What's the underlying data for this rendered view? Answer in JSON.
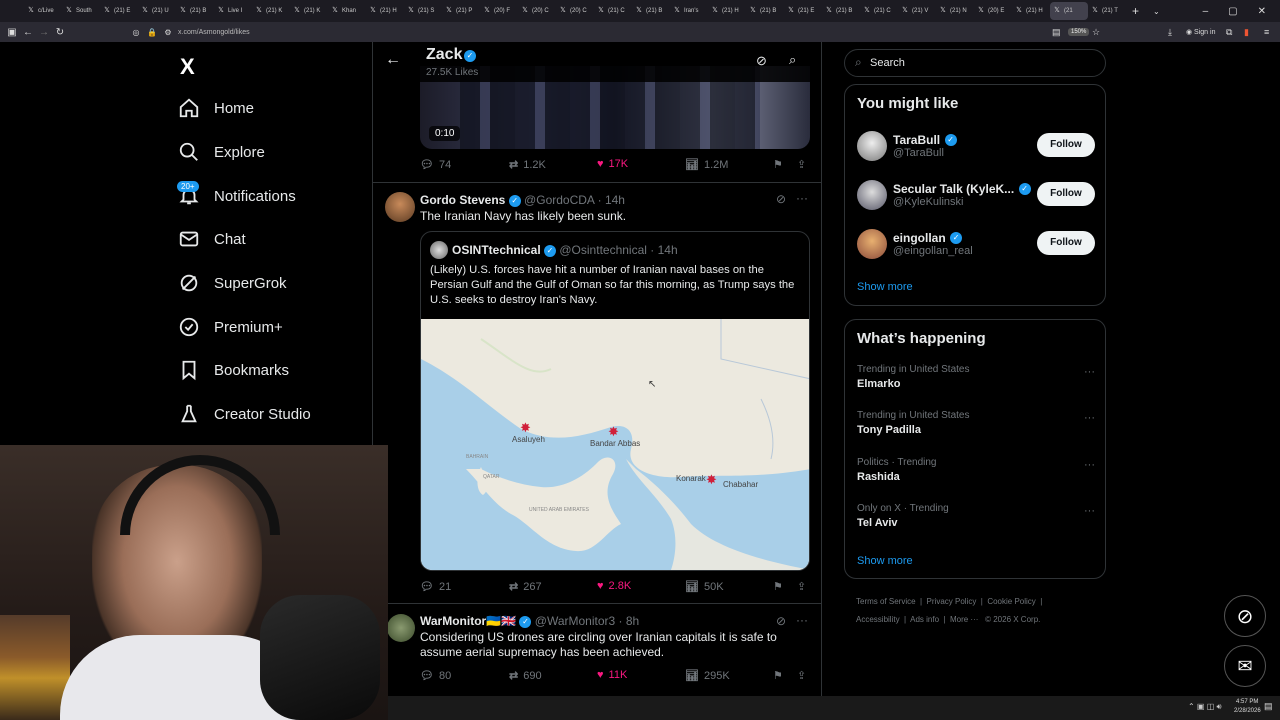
{
  "browser": {
    "tabs": [
      {
        "label": "c/Live"
      },
      {
        "label": "South"
      },
      {
        "label": "(21) E"
      },
      {
        "label": "(21) U"
      },
      {
        "label": "(21) B"
      },
      {
        "label": "Live I"
      },
      {
        "label": "(21) K"
      },
      {
        "label": "(21) K"
      },
      {
        "label": "Khan"
      },
      {
        "label": "(21) H"
      },
      {
        "label": "(21) S"
      },
      {
        "label": "(21) P"
      },
      {
        "label": "(20) F"
      },
      {
        "label": "(20) C"
      },
      {
        "label": "(20) C"
      },
      {
        "label": "(21) C"
      },
      {
        "label": "(21) B"
      },
      {
        "label": "Iran's"
      },
      {
        "label": "(21) H"
      },
      {
        "label": "(21) B"
      },
      {
        "label": "(21) E"
      },
      {
        "label": "(21) B"
      },
      {
        "label": "(21) C"
      },
      {
        "label": "(21) V"
      },
      {
        "label": "(21) N"
      },
      {
        "label": "(20) E"
      },
      {
        "label": "(21) H"
      },
      {
        "label": "(21"
      },
      {
        "label": "(21) T"
      }
    ],
    "url": "x.com/Asmongold/likes",
    "zoom": "150%"
  },
  "sidebar": {
    "logo": "X",
    "notif_badge": "20+",
    "items": [
      {
        "label": "Home"
      },
      {
        "label": "Explore"
      },
      {
        "label": "Notifications"
      },
      {
        "label": "Chat"
      },
      {
        "label": "SuperGrok"
      },
      {
        "label": "Premium+"
      },
      {
        "label": "Bookmarks"
      },
      {
        "label": "Creator Studio"
      }
    ]
  },
  "header": {
    "name": "Zack",
    "subtitle": "27.5K Likes"
  },
  "post0": {
    "video_time": "0:10",
    "replies": "74",
    "reposts": "1.2K",
    "likes": "17K",
    "views": "1.2M"
  },
  "post1": {
    "name": "Gordo Stevens",
    "handle": "@GordoCDA",
    "time": "· 14h",
    "text": "The Iranian Navy has likely been sunk.",
    "quote": {
      "name": "OSINTtechnical",
      "handle": "@Osinttechnical",
      "time": "· 14h",
      "text": "(Likely) U.S. forces have hit a number of Iranian naval bases on the Persian Gulf and the Gulf of Oman so far this morning, as Trump says the U.S. seeks to destroy Iran's Navy."
    },
    "map_labels": {
      "asaluyeh": "Asaluyeh",
      "bandar": "Bandar Abbas",
      "konarak": "Konarak",
      "chabahar": "Chabahar",
      "bahrain": "BAHRAIN",
      "qatar": "QATAR",
      "uae": "UNITED ARAB EMIRATES"
    },
    "replies": "21",
    "reposts": "267",
    "likes": "2.8K",
    "views": "50K"
  },
  "post2": {
    "name": "WarMonitor🇺🇦🇬🇧",
    "handle": "@WarMonitor3",
    "time": "· 8h",
    "text": "Considering US drones are circling over Iranian capitals it is safe to assume aerial supremacy has been achieved.",
    "replies": "80",
    "reposts": "690",
    "likes": "11K",
    "views": "295K"
  },
  "search": {
    "placeholder": "Search"
  },
  "suggestions": {
    "title": "You might like",
    "users": [
      {
        "name": "TaraBull",
        "handle": "@TaraBull",
        "button": "Follow"
      },
      {
        "name": "Secular Talk (KyleK...",
        "handle": "@KyleKulinski",
        "button": "Follow"
      },
      {
        "name": "eingollan",
        "handle": "@eingollan_real",
        "button": "Follow"
      }
    ],
    "show_more": "Show more"
  },
  "trends": {
    "title": "What’s happening",
    "items": [
      {
        "context": "Trending in United States",
        "name": "Elmarko"
      },
      {
        "context": "Trending in United States",
        "name": "Tony Padilla"
      },
      {
        "context": "Politics · Trending",
        "name": "Rashida"
      },
      {
        "context": "Only on X · Trending",
        "name": "Tel Aviv"
      }
    ],
    "show_more": "Show more"
  },
  "footer": {
    "terms": "Terms of Service",
    "privacy": "Privacy Policy",
    "cookie": "Cookie Policy",
    "accessibility": "Accessibility",
    "ads": "Ads info",
    "more": "More ···",
    "copyright": "© 2026 X Corp."
  },
  "taskbar": {
    "time": "4:57 PM",
    "date": "2/28/2026"
  },
  "colors": {
    "accent": "#1d9bf0",
    "like": "#f91880",
    "bg": "#000000"
  }
}
